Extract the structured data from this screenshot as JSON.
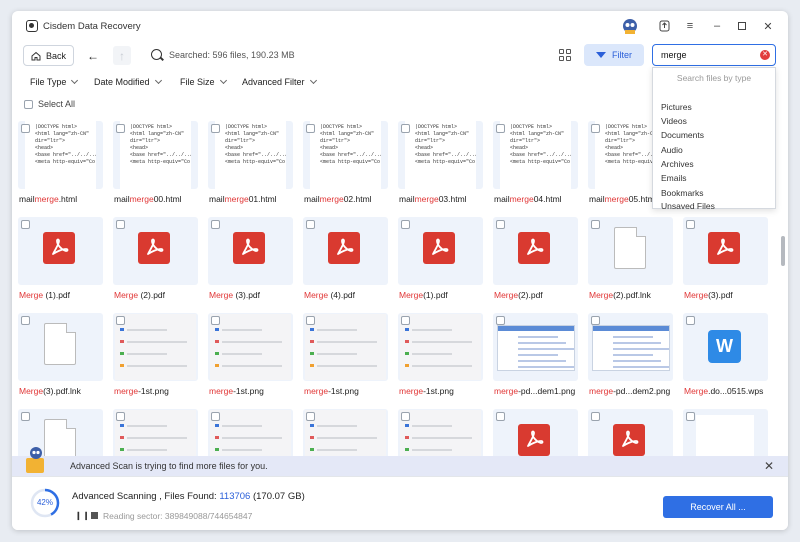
{
  "app": {
    "title": "Cisdem Data Recovery"
  },
  "toolbar": {
    "back_label": "Back",
    "searched_text": "Searched: 596 files, 190.23 MB",
    "filter_label": "Filter",
    "search_value": "merge"
  },
  "filters": [
    {
      "label": "File Type"
    },
    {
      "label": "Date Modified"
    },
    {
      "label": "File Size"
    },
    {
      "label": "Advanced Filter"
    }
  ],
  "select_all_label": "Select All",
  "search_dropdown": {
    "header": "Search files by type",
    "options": [
      "Pictures",
      "Videos",
      "Documents",
      "Audio",
      "Archives",
      "Emails",
      "Bookmarks",
      "Unsaved Files"
    ]
  },
  "html_snippet": "|DOCTYPE html>\n<html lang=\"zh-CN\"\ndir=\"ltr\">\n<head>\n<base href=\"../../../\">\n<meta http-equiv=\"Co",
  "rows": [
    [
      {
        "kind": "html",
        "pre": "mail",
        "hl": "merge",
        "post": ".html"
      },
      {
        "kind": "html",
        "pre": "mail",
        "hl": "merge",
        "post": "00.html"
      },
      {
        "kind": "html",
        "pre": "mail",
        "hl": "merge",
        "post": "01.html"
      },
      {
        "kind": "html",
        "pre": "mail",
        "hl": "merge",
        "post": "02.html"
      },
      {
        "kind": "html",
        "pre": "mail",
        "hl": "merge",
        "post": "03.html"
      },
      {
        "kind": "html",
        "pre": "mail",
        "hl": "merge",
        "post": "04.html"
      },
      {
        "kind": "html",
        "pre": "mail",
        "hl": "merge",
        "post": "05.html"
      }
    ],
    [
      {
        "kind": "pdf",
        "pre": "",
        "hl": "Merge",
        "post": " (1).pdf"
      },
      {
        "kind": "pdf",
        "pre": "",
        "hl": "Merge",
        "post": " (2).pdf"
      },
      {
        "kind": "pdf",
        "pre": "",
        "hl": "Merge",
        "post": " (3).pdf"
      },
      {
        "kind": "pdf",
        "pre": "",
        "hl": "Merge",
        "post": " (4).pdf"
      },
      {
        "kind": "pdf",
        "pre": "",
        "hl": "Merge",
        "post": "(1).pdf"
      },
      {
        "kind": "pdf",
        "pre": "",
        "hl": "Merge",
        "post": "(2).pdf"
      },
      {
        "kind": "blank",
        "pre": "",
        "hl": "Merge",
        "post": "(2).pdf.lnk"
      },
      {
        "kind": "pdf",
        "pre": "",
        "hl": "Merge",
        "post": "(3).pdf"
      }
    ],
    [
      {
        "kind": "blank",
        "pre": "",
        "hl": "Merge",
        "post": "(3).pdf.lnk"
      },
      {
        "kind": "shot",
        "pre": "",
        "hl": "merge",
        "post": "-1st.png"
      },
      {
        "kind": "shot",
        "pre": "",
        "hl": "merge",
        "post": "-1st.png"
      },
      {
        "kind": "shot",
        "pre": "",
        "hl": "merge",
        "post": "-1st.png"
      },
      {
        "kind": "shot",
        "pre": "",
        "hl": "merge",
        "post": "-1st.png"
      },
      {
        "kind": "pd",
        "pre": "",
        "hl": "merge",
        "post": "-pd...dem1.png"
      },
      {
        "kind": "pd",
        "pre": "",
        "hl": "merge",
        "post": "-pd...dem2.png"
      },
      {
        "kind": "wps",
        "pre": "",
        "hl": "Merge",
        "post": ".do...0515.wps"
      }
    ],
    [
      {
        "kind": "blank"
      },
      {
        "kind": "shot"
      },
      {
        "kind": "shot"
      },
      {
        "kind": "shot"
      },
      {
        "kind": "shot"
      },
      {
        "kind": "pdf"
      },
      {
        "kind": "pdf"
      },
      {
        "kind": "white"
      }
    ]
  ],
  "notice": {
    "message": "Advanced Scan is trying to find more files for you."
  },
  "status": {
    "progress": "42%",
    "progress_value": 0.42,
    "scan_label": "Advanced Scanning , Files Found: ",
    "files_found": "113706",
    "size": " (170.07 GB)",
    "sector": "Reading sector: 389849088/744654847",
    "recover_label": "Recover All ..."
  },
  "colors": {
    "accent": "#2f6fe4",
    "highlight": "#e13737",
    "pdf_red": "#d93a30"
  }
}
